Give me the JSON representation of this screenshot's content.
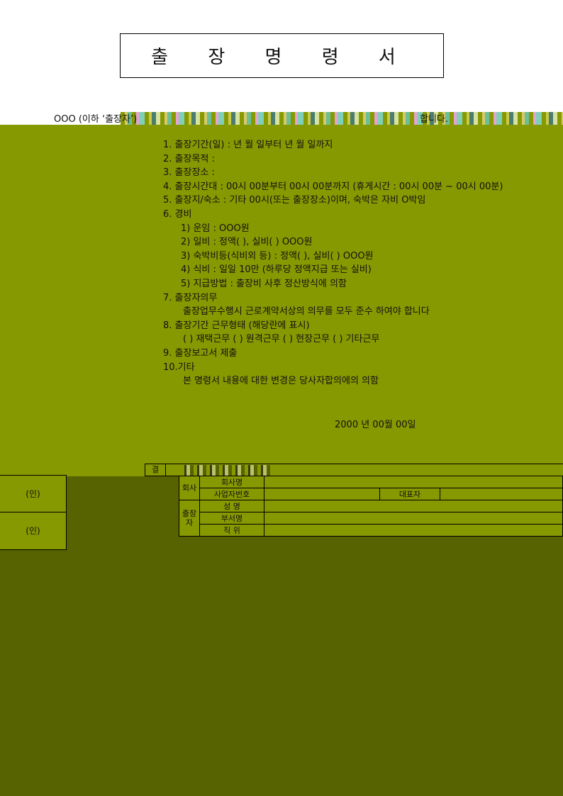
{
  "document": {
    "title": "출 장 명 령 서",
    "intro_left": "OOO (이하 ‘출장자’)",
    "intro_right": "합니다.",
    "items": [
      "1.  출장기간(일) :        년    월     일부터        년    월     일까지",
      "2.  출장목적 :",
      "3.  출장장소 :",
      "4.  출장시간대 : 00시 00분부터 00시 00분까지 (휴게시간 : 00시 00분 ~ 00시 00분)",
      "5.  출장지/숙소 : 기타 00시(또는 출장장소)이며, 숙박은 자비 O박임",
      "6.  경비",
      "1)  운임 : OOO원",
      "2)  일비 : 정액(     ), 실비(     ) OOO원",
      "3)  숙박비등(식비외 등) : 정액(     ), 실비(     ) OOO원",
      "4)  식비 : 일일 10만 (하루당 정액지급 또는 실비)",
      "5)  지급방법 : 출장비 사후 정산방식에 의함",
      "7.  출장자의무",
      "출장업무수행시 근로계약서상의 의무를 모두 준수 하여야 합니다",
      "8.  출장기간 근무형태 (해당란에 표시)",
      "(   ) 재택근무    (   ) 원격근무    (   ) 현장근무    (   ) 기타근무",
      "9.  출장보고서 제출",
      "10.기타",
      "본 명령서 내용에 대한 변경은 당사자합의에의 의함"
    ],
    "date": "2000 년 00월 00일"
  },
  "approval": {
    "top_cell": "결",
    "stamp_cells": [
      "(인)",
      "(인)"
    ],
    "rows": [
      {
        "side": "회사",
        "label": "회사명",
        "value": "",
        "extra_label": "",
        "extra_value": ""
      },
      {
        "side": "",
        "label": "사업자번호",
        "value": "",
        "extra_label": "대표자",
        "extra_value": ""
      },
      {
        "side": "출장자",
        "label": "성   명",
        "value": "",
        "extra_label": "",
        "extra_value": ""
      },
      {
        "side": "",
        "label": "부서명",
        "value": "",
        "extra_label": "",
        "extra_value": ""
      },
      {
        "side": "",
        "label": "직   위",
        "value": "",
        "extra_label": "",
        "extra_value": ""
      }
    ]
  }
}
